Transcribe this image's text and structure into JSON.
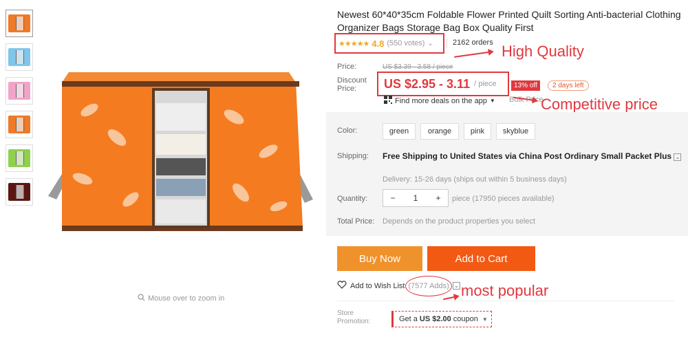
{
  "thumbnails": [
    {
      "color": "#f07a28"
    },
    {
      "color": "#7fc6ea"
    },
    {
      "color": "#f2a3c9"
    },
    {
      "color": "#f07a28"
    },
    {
      "color": "#8fd14f"
    },
    {
      "color": "#5a1712"
    }
  ],
  "zoom_hint": "Mouse over to zoom in",
  "product": {
    "title": "Newest 60*40*35cm Foldable Flower Printed Quilt Sorting Anti-bacterial Clothing Organizer Bags Storage Bag Box Quality First",
    "stars": "★★★★★",
    "rating": "4.8",
    "votes": "(550 votes)",
    "orders": "2162 orders"
  },
  "price": {
    "price_label": "Price:",
    "old_price": "US $3.39 - 3.58 / piece",
    "discount_label_1": "Discount",
    "discount_label_2": "Price:",
    "discount_price": "US $2.95 - 3.11",
    "per_unit": "/ piece",
    "off_badge": "13% off",
    "days_left": "2 days left",
    "app_deals": "Find more deals on the app",
    "bulk_price": "Bulk Price"
  },
  "annotations": {
    "high_quality": "High Quality",
    "competitive_price": "Competitive price",
    "most_popular": "most popular"
  },
  "options": {
    "color_label": "Color:",
    "colors": [
      "green",
      "orange",
      "pink",
      "skyblue"
    ],
    "shipping_label": "Shipping:",
    "shipping_text": "Free Shipping to United States via China Post Ordinary Small Packet Plus",
    "delivery": "Delivery: 15-26 days (ships out within 5 business days)",
    "quantity_label": "Quantity:",
    "quantity_minus": "−",
    "quantity_value": "1",
    "quantity_plus": "+",
    "quantity_available": "piece (17950 pieces available)",
    "total_label": "Total Price:",
    "total_text": "Depends on the product properties you select"
  },
  "actions": {
    "buy_now": "Buy Now",
    "add_to_cart": "Add to Cart",
    "wish_list": "Add to Wish List",
    "adds": "(7577 Adds)"
  },
  "store": {
    "label_1": "Store",
    "label_2": "Promotion:",
    "coupon_prefix": "Get a",
    "coupon_amount": "US $2.00",
    "coupon_suffix": "coupon"
  },
  "colors": {
    "accent_red": "#e0383e",
    "buy_orange": "#f0922b",
    "cart_orange": "#f25a14",
    "star_gold": "#f5a623"
  }
}
